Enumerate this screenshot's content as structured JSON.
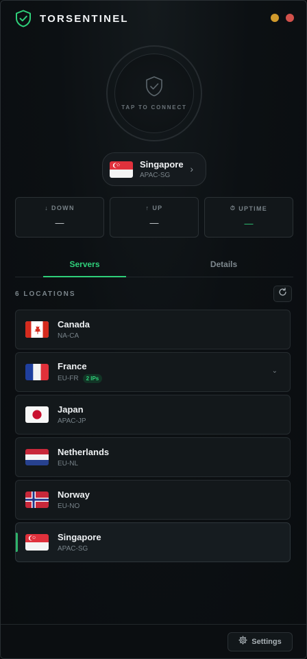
{
  "app": {
    "title": "TORSENTINEL"
  },
  "window_controls": {
    "minimize": "minimize",
    "close": "close"
  },
  "connect": {
    "label": "TAP TO CONNECT",
    "state": "disconnected"
  },
  "selected_server": {
    "name": "Singapore",
    "code": "APAC-SG",
    "flag": "sg"
  },
  "stats": [
    {
      "label": "DOWN",
      "icon": "arrow-down-icon",
      "glyph": "↓",
      "value": "—"
    },
    {
      "label": "UP",
      "icon": "arrow-up-icon",
      "glyph": "↑",
      "value": "—"
    },
    {
      "label": "UPTIME",
      "icon": "stopwatch-icon",
      "glyph": "⏱",
      "value": "—"
    }
  ],
  "tabs": [
    {
      "label": "Servers",
      "active": true
    },
    {
      "label": "Details",
      "active": false
    }
  ],
  "locations": {
    "count_label": "6 LOCATIONS",
    "items": [
      {
        "name": "Canada",
        "code": "NA-CA",
        "flag": "ca"
      },
      {
        "name": "France",
        "code": "EU-FR",
        "flag": "fr",
        "badge": "2 IPs",
        "expandable": true
      },
      {
        "name": "Japan",
        "code": "APAC-JP",
        "flag": "jp"
      },
      {
        "name": "Netherlands",
        "code": "EU-NL",
        "flag": "nl"
      },
      {
        "name": "Norway",
        "code": "EU-NO",
        "flag": "no"
      },
      {
        "name": "Singapore",
        "code": "APAC-SG",
        "flag": "sg",
        "selected": true
      }
    ]
  },
  "footer": {
    "settings_label": "Settings"
  },
  "colors": {
    "accent": "#2fd07a",
    "minimize": "#d19a2c",
    "close": "#d2514b"
  }
}
